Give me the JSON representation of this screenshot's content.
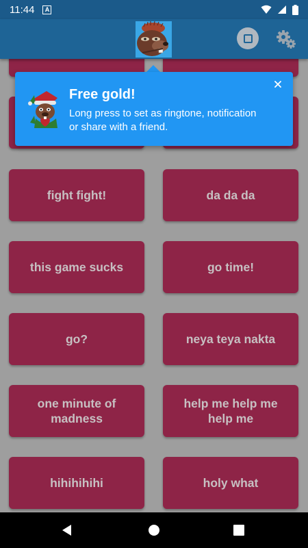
{
  "status_bar": {
    "time": "11:44",
    "notification_letter": "A",
    "icons": [
      "wifi-icon",
      "signal-icon",
      "battery-icon"
    ]
  },
  "app_bar": {
    "logo": "beaver-avatar",
    "actions": [
      "stop-icon",
      "settings-gear-icon"
    ]
  },
  "tooltip": {
    "title": "Free gold!",
    "text": "Long press to set as ringtone, notification or share with a friend.",
    "icon": "elf-beaver-icon",
    "close": "close-icon"
  },
  "sounds": [
    {
      "left": "",
      "right": ""
    },
    {
      "left": "",
      "right": ""
    },
    {
      "left": "fight fight!",
      "right": "da da da"
    },
    {
      "left": "this game sucks",
      "right": "go time!"
    },
    {
      "left": "go?",
      "right": "neya teya nakta"
    },
    {
      "left": "one minute of madness",
      "right": "help me help me help me"
    },
    {
      "left": "hihihihihi",
      "right": "holy what"
    }
  ],
  "colors": {
    "status_bar": "#1b5a8a",
    "app_bar": "#1e6496",
    "tooltip": "#2196f3",
    "sound_button": "#8e2447",
    "sound_text": "#c7c0c2",
    "background": "#9e9e9e"
  },
  "nav_bar": {
    "buttons": [
      "back-icon",
      "home-icon",
      "recents-icon"
    ]
  }
}
